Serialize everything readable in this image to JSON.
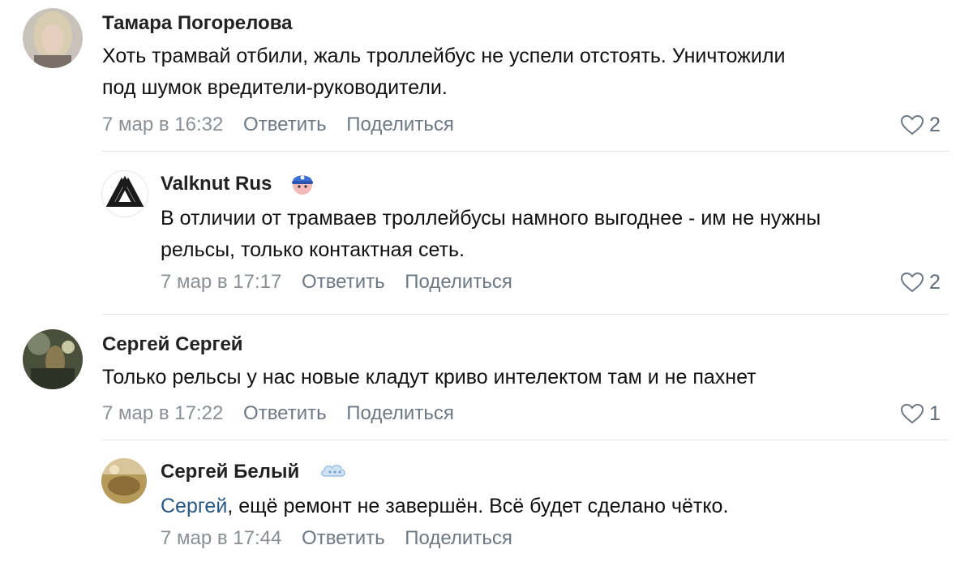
{
  "comments": [
    {
      "author": "Тамара Погорелова",
      "text_line1": "Хоть трамвай отбили, жаль троллейбус не успели отстоять. Уничтожили",
      "text_line2": "под шумок вредители-руководители.",
      "date": "7 мар в 16:32",
      "reply_label": "Ответить",
      "share_label": "Поделиться",
      "likes": "2"
    },
    {
      "author": "Valknut Rus",
      "text_line1": "В отличии от трамваев троллейбусы намного выгоднее - им не нужны",
      "text_line2": "рельсы, только контактная сеть.",
      "date": "7 мар в 17:17",
      "reply_label": "Ответить",
      "share_label": "Поделиться",
      "likes": "2"
    },
    {
      "author": "Сергей Сергей",
      "text_line1": "Только рельсы у нас новые кладут криво интелектом там и не пахнет",
      "date": "7 мар в 17:22",
      "reply_label": "Ответить",
      "share_label": "Поделиться",
      "likes": "1"
    },
    {
      "author": "Сергей Белый",
      "mention": "Сергей",
      "text_rest": ", ещё ремонт не завершён. Всё будет сделано чётко.",
      "date": "7 мар в 17:44",
      "reply_label": "Ответить",
      "share_label": "Поделиться"
    }
  ],
  "colors": {
    "meta": "#8a8f96",
    "link": "#2a5885",
    "divider": "#e3e5e8"
  },
  "icons": [
    "heart-icon",
    "valknut-avatar-icon",
    "cap-badge-icon",
    "cloud-badge-icon"
  ]
}
